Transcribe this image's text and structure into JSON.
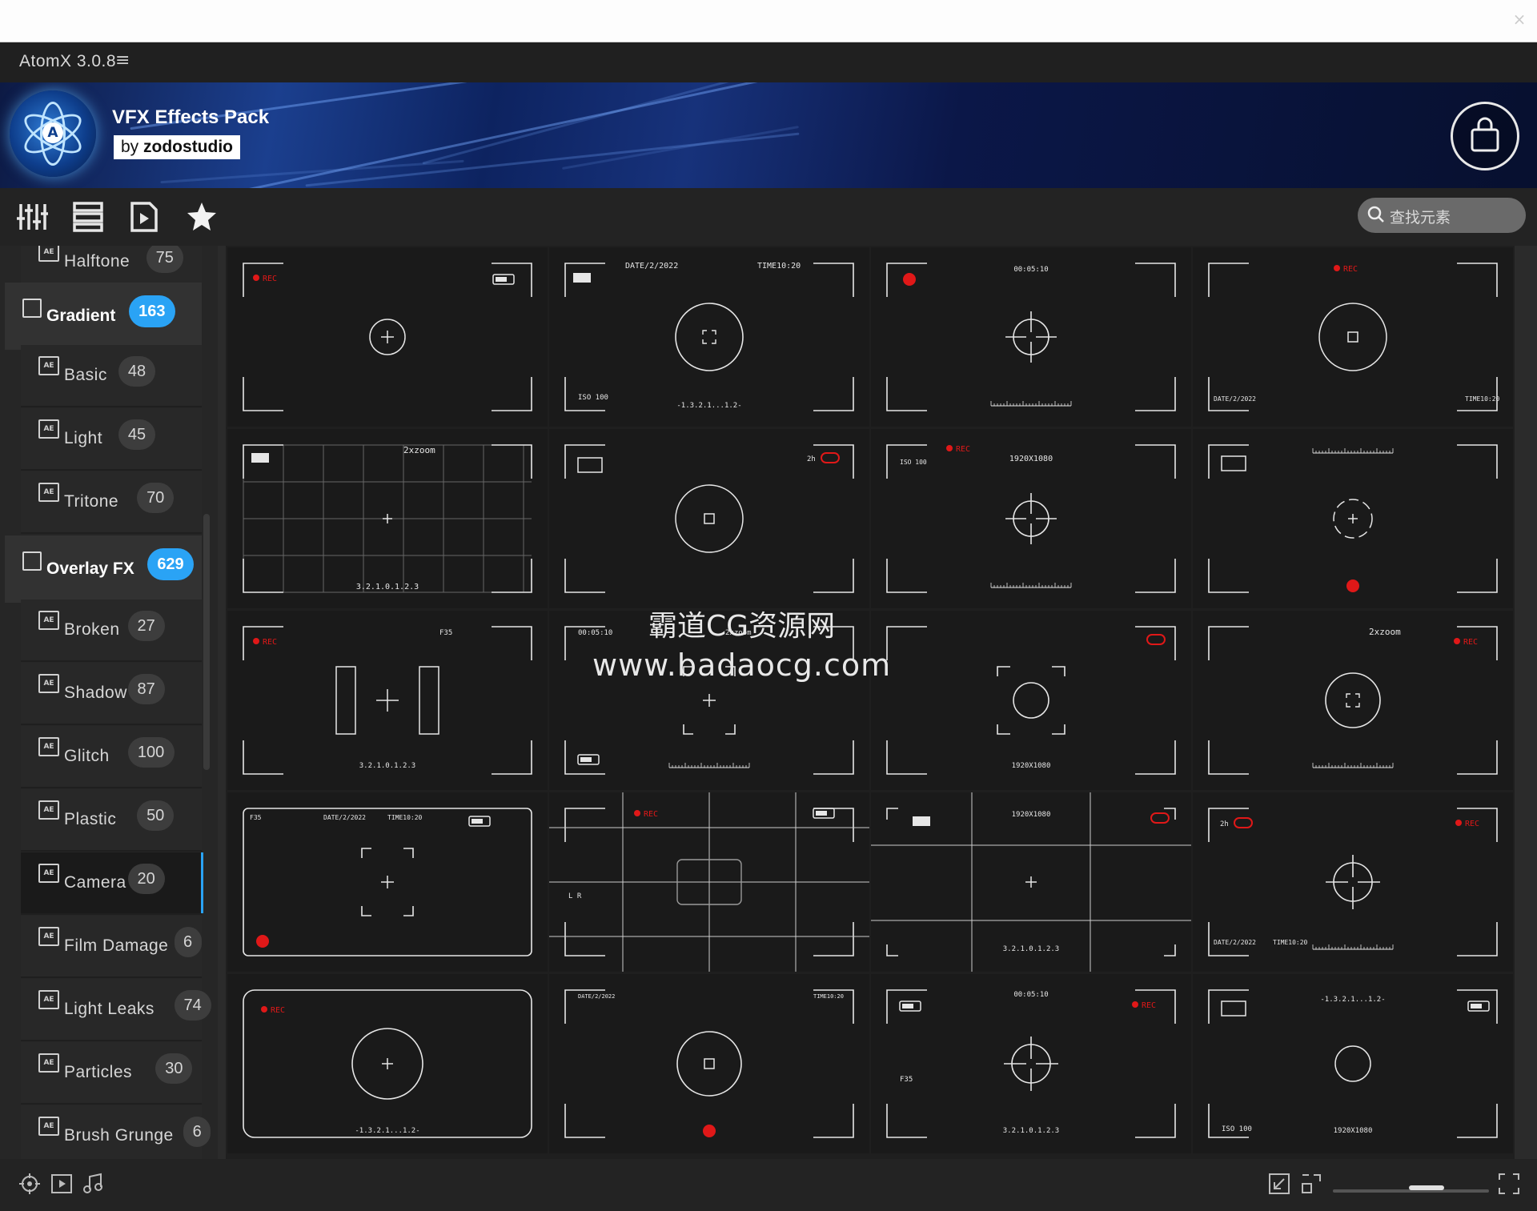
{
  "app": {
    "title": "AtomX 3.0.8",
    "menu_icon": "hamburger-icon"
  },
  "banner": {
    "title": "VFX Effects Pack",
    "by_prefix": "by",
    "by_name": "zodostudio",
    "logo": "atom-logo",
    "cart_icon": "shopping-bag-icon"
  },
  "toolbar": {
    "icons": [
      "sliders-icon",
      "list-icon",
      "document-play-icon",
      "star-icon"
    ],
    "search_placeholder": "查找元素"
  },
  "sidebar": {
    "items": [
      {
        "type": "sub",
        "label": "Halftone",
        "count": "75"
      },
      {
        "type": "cat",
        "label": "Gradient",
        "count": "163"
      },
      {
        "type": "sub",
        "label": "Basic",
        "count": "48"
      },
      {
        "type": "sub",
        "label": "Light",
        "count": "45"
      },
      {
        "type": "sub",
        "label": "Tritone",
        "count": "70"
      },
      {
        "type": "cat",
        "label": "Overlay FX",
        "count": "629"
      },
      {
        "type": "sub",
        "label": "Broken",
        "count": "27"
      },
      {
        "type": "sub",
        "label": "Shadow",
        "count": "87"
      },
      {
        "type": "sub",
        "label": "Glitch",
        "count": "100"
      },
      {
        "type": "sub",
        "label": "Plastic",
        "count": "50"
      },
      {
        "type": "sub",
        "label": "Camera",
        "count": "20",
        "selected": true
      },
      {
        "type": "sub",
        "label": "Film Damage",
        "count": "6"
      },
      {
        "type": "sub",
        "label": "Light Leaks",
        "count": "74"
      },
      {
        "type": "sub",
        "label": "Particles",
        "count": "30"
      },
      {
        "type": "sub",
        "label": "Brush Grunge",
        "count": "6"
      }
    ]
  },
  "grid": {
    "texts": {
      "rec": "REC",
      "date": "DATE/2/2022",
      "time": "TIME10:20",
      "timecode": "00:05:10",
      "iso": "ISO 100",
      "zoom": "2xzoom",
      "resolution": "1920X1080",
      "scale": "3.2.1.0.1.2.3",
      "scale_short": "-1.3.2.1...1.2-",
      "aperture": "F35",
      "lr": "L R",
      "battery_time": "2h"
    }
  },
  "watermark": {
    "line1": "霸道CG资源网",
    "line2": "www.badaocg.com"
  },
  "bottombar": {
    "icons": [
      "move-icon",
      "video-icon",
      "music-icon",
      "import-icon",
      "fit-icon",
      "fullscreen-icon"
    ]
  },
  "colors": {
    "accent": "#2aa3f5",
    "rec_red": "#e01818"
  }
}
